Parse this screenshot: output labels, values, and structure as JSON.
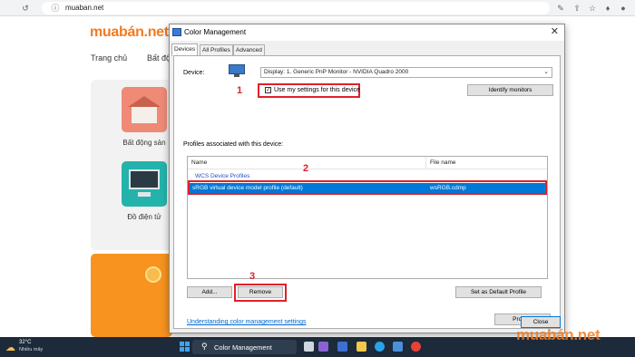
{
  "browser": {
    "url": "muaban.net",
    "icons": [
      "back-icon",
      "reload-icon",
      "site-info-icon",
      "translate-icon",
      "share-icon",
      "bookmark-icon",
      "extensions-icon",
      "profile-icon"
    ]
  },
  "site": {
    "logo": "muabán.net",
    "nav": [
      "Trang chủ",
      "Bất độ"
    ],
    "categories": [
      {
        "label": "Bất động sản",
        "icon": "house-icon"
      },
      {
        "label": "Đồ điện tử",
        "icon": "electronics-icon"
      }
    ]
  },
  "dialog": {
    "title": "Color Management",
    "tabs": [
      "Devices",
      "All Profiles",
      "Advanced"
    ],
    "active_tab": "Devices",
    "device_label": "Device:",
    "device_value": "Display: 1. Generic PnP Monitor - NVIDIA Quadro 2000",
    "use_settings_label": "Use my settings for this device",
    "use_settings_checked": true,
    "identify_button": "Identify monitors",
    "profiles_label": "Profiles associated with this device:",
    "table": {
      "columns": [
        "Name",
        "File name"
      ],
      "group": "WCS Device Profiles",
      "rows": [
        {
          "name": "sRGB virtual device model profile (default)",
          "file": "wsRGB.cdmp",
          "selected": true
        }
      ]
    },
    "add_button": "Add...",
    "remove_button": "Remove",
    "set_default_button": "Set as Default Profile",
    "link": "Understanding color management settings",
    "profiles_button": "Profiles",
    "close_button": "Close"
  },
  "annotations": [
    "1",
    "2",
    "3"
  ],
  "taskbar": {
    "temperature": "32°C",
    "weather": "Nhiều mây",
    "search_text": "Color Management"
  },
  "watermark": "muabán.net",
  "colors": {
    "brand": "#f27b1f",
    "selection": "#0078d7",
    "annotation": "#e0202a"
  }
}
